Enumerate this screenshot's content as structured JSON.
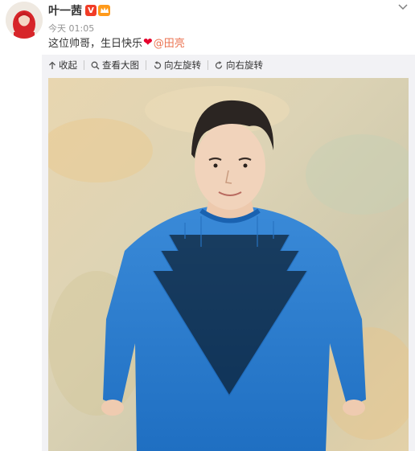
{
  "post": {
    "author_name": "叶一茜",
    "verified_badge_text": "V",
    "timestamp": "今天 01:05",
    "text_before": "这位帅哥，生日快乐",
    "heart_emoji": "❤",
    "mention": "@田亮"
  },
  "media": {
    "toolbar": [
      {
        "label": "收起",
        "icon": "collapse-icon"
      },
      {
        "label": "查看大图",
        "icon": "zoom-icon"
      },
      {
        "label": "向左旋转",
        "icon": "rotate-left-icon"
      },
      {
        "label": "向右旋转",
        "icon": "rotate-right-icon"
      }
    ]
  },
  "colors": {
    "mention": "#eb7350",
    "vip": "#f13c26",
    "panel_bg": "#f2f2f5",
    "sweater": "#2f7fd2"
  }
}
